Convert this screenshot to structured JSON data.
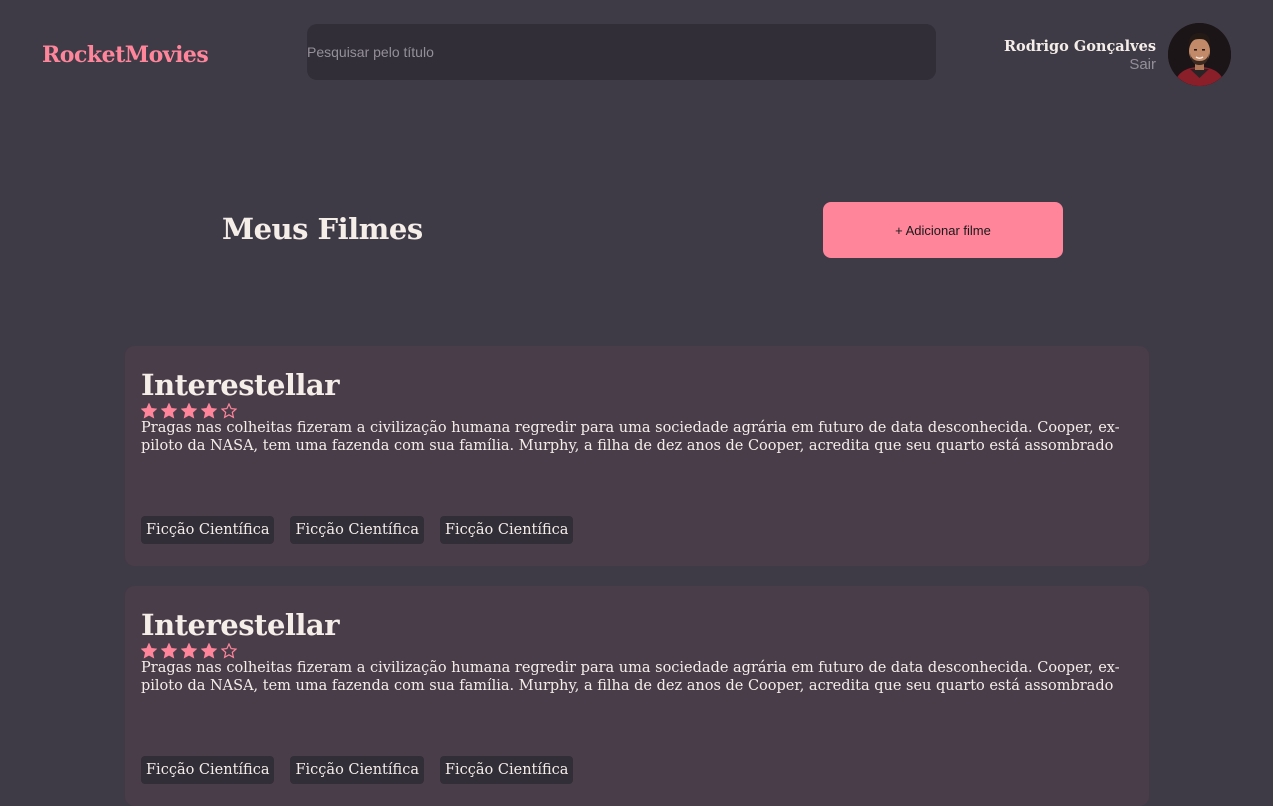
{
  "header": {
    "brand": "RocketMovies",
    "search_placeholder": "Pesquisar pelo título",
    "user_name": "Rodrigo Gonçalves",
    "signout_label": "Sair"
  },
  "main": {
    "title": "Meus Filmes",
    "add_button_label": "+ Adicionar filme"
  },
  "movies": [
    {
      "title": "Interestellar",
      "rating": 4,
      "rating_max": 5,
      "description": "Pragas nas colheitas fizeram a civilização humana regredir para uma sociedade agrária em futuro de data desconhecida. Cooper, ex-piloto da NASA, tem uma fazenda com sua família. Murphy, a filha de dez anos de Cooper, acredita que seu quarto está assombrado por um fantasma que te",
      "tags": [
        "Ficção Científica",
        "Ficção Científica",
        "Ficção Científica"
      ]
    },
    {
      "title": "Interestellar",
      "rating": 4,
      "rating_max": 5,
      "description": "Pragas nas colheitas fizeram a civilização humana regredir para uma sociedade agrária em futuro de data desconhecida. Cooper, ex-piloto da NASA, tem uma fazenda com sua família. Murphy, a filha de dez anos de Cooper, acredita que seu quarto está assombrado por um fantasma que te",
      "tags": [
        "Ficção Científica",
        "Ficção Científica",
        "Ficção Científica"
      ]
    }
  ],
  "colors": {
    "background": "#3e3b47",
    "accent": "#ff859b",
    "card": "#4a3d4a",
    "input": "#312e38",
    "text": "#f4ede8",
    "muted": "#948f99"
  },
  "icons": {
    "star_filled": "star-filled-icon",
    "star_empty": "star-outline-icon"
  }
}
